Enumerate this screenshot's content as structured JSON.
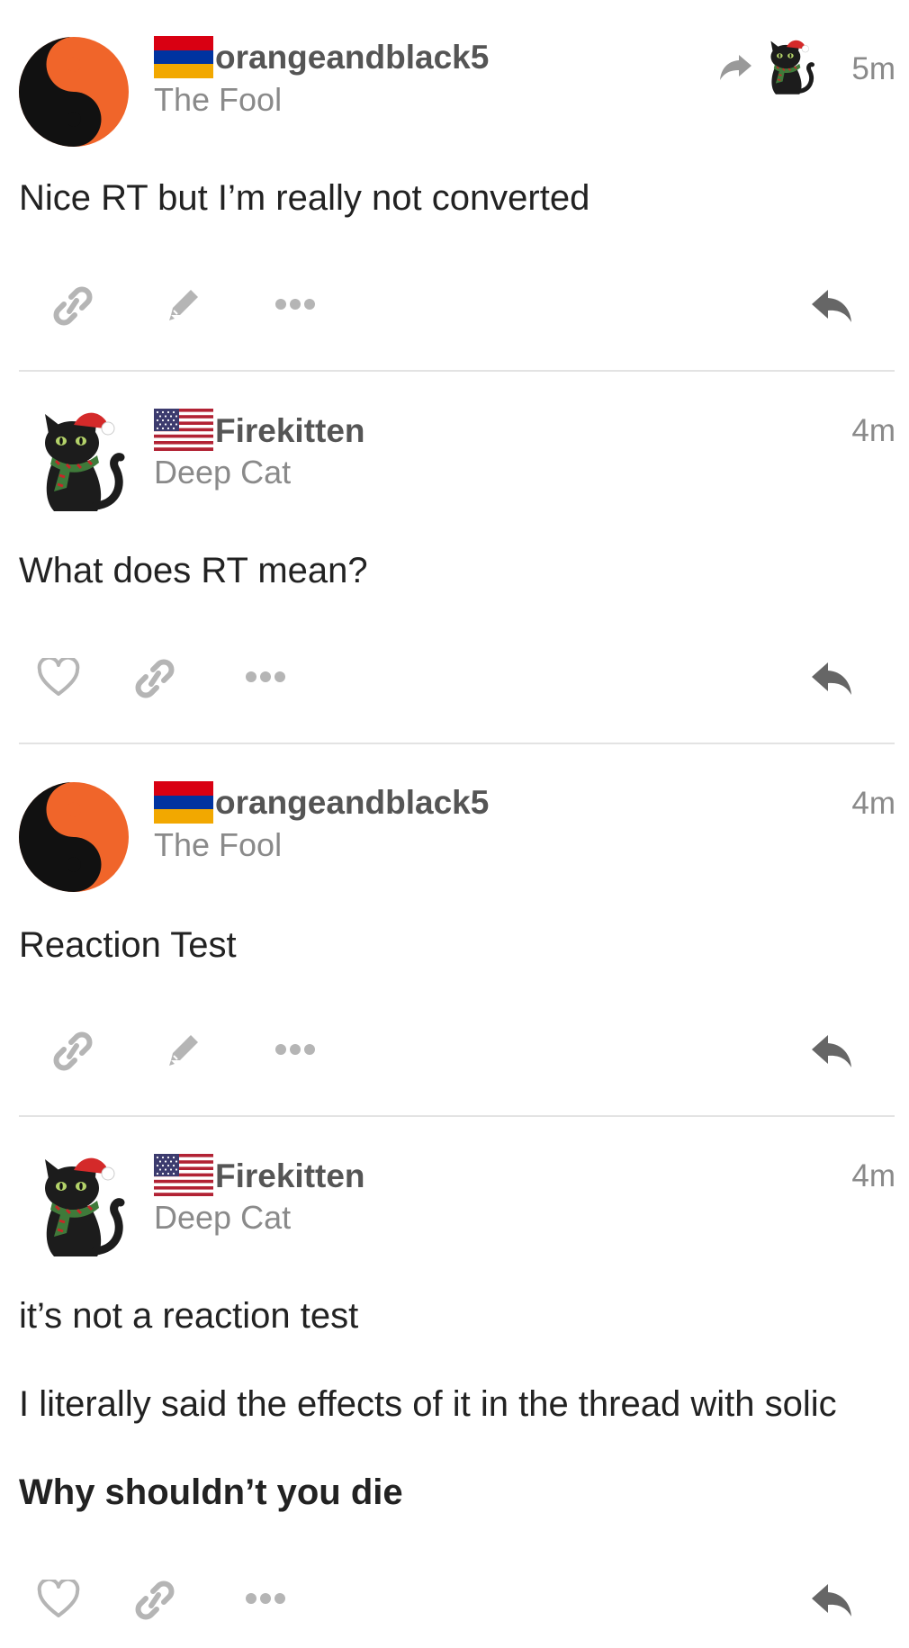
{
  "posts": [
    {
      "username": "orangeandblack5",
      "user_title": "The Fool",
      "time": "5m",
      "flag": "armenia-flag",
      "avatar": "yin-yang-avatar",
      "has_reply_to": true,
      "lines": [
        "Nice RT but I’m really not converted"
      ],
      "actions": [
        "link-icon",
        "edit-icon",
        "more-icon",
        "reply-icon"
      ]
    },
    {
      "username": "Firekitten",
      "user_title": "Deep Cat",
      "time": "4m",
      "flag": "usa-flag",
      "avatar": "black-cat-santa-avatar",
      "lines": [
        "What does RT mean?"
      ],
      "actions": [
        "heart-icon",
        "link-icon",
        "more-icon",
        "reply-icon"
      ]
    },
    {
      "username": "orangeandblack5",
      "user_title": "The Fool",
      "time": "4m",
      "flag": "armenia-flag",
      "avatar": "yin-yang-avatar",
      "lines": [
        "Reaction Test"
      ],
      "actions": [
        "link-icon",
        "edit-icon",
        "more-icon",
        "reply-icon"
      ]
    },
    {
      "username": "Firekitten",
      "user_title": "Deep Cat",
      "time": "4m",
      "flag": "usa-flag",
      "avatar": "black-cat-santa-avatar",
      "lines": [
        "it’s not a reaction test",
        "I literally said the effects of it in the thread with solic",
        "Why shouldn’t you die"
      ],
      "bold_line_index": 2,
      "actions": [
        "heart-icon",
        "link-icon",
        "more-icon",
        "reply-icon"
      ]
    }
  ],
  "colors": {
    "username": "#555555",
    "meta": "#8a8a8a",
    "icon": "#b5b5b5",
    "reply_icon": "#666666",
    "yin_yang_orange": "#f0652a",
    "divider": "#e3e3e3"
  }
}
